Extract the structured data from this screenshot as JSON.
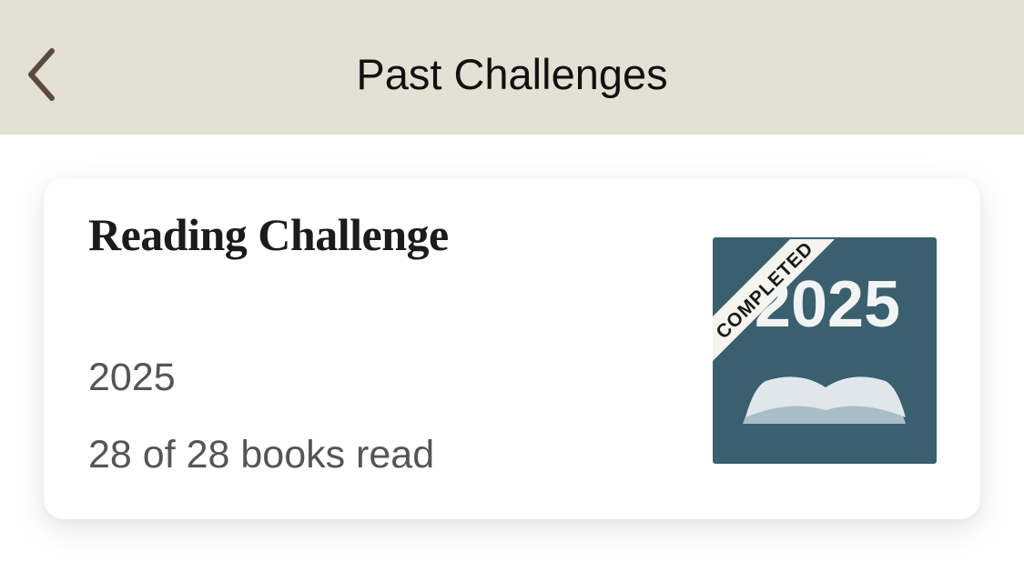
{
  "header": {
    "title": "Past Challenges",
    "back_icon": "chevron-left-icon"
  },
  "challenge_card": {
    "title": "Reading Challenge",
    "year": "2025",
    "progress_text": "28 of 28 books read",
    "books_read": 28,
    "books_goal": 28,
    "badge": {
      "year_text": "2025",
      "ribbon_text": "COMPLETED",
      "icon": "open-book-icon",
      "background_color": "#3a5f6e"
    }
  },
  "colors": {
    "header_background": "#e3e1d3",
    "badge_background": "#3a5f6e",
    "back_chevron": "#5b4a3f"
  }
}
